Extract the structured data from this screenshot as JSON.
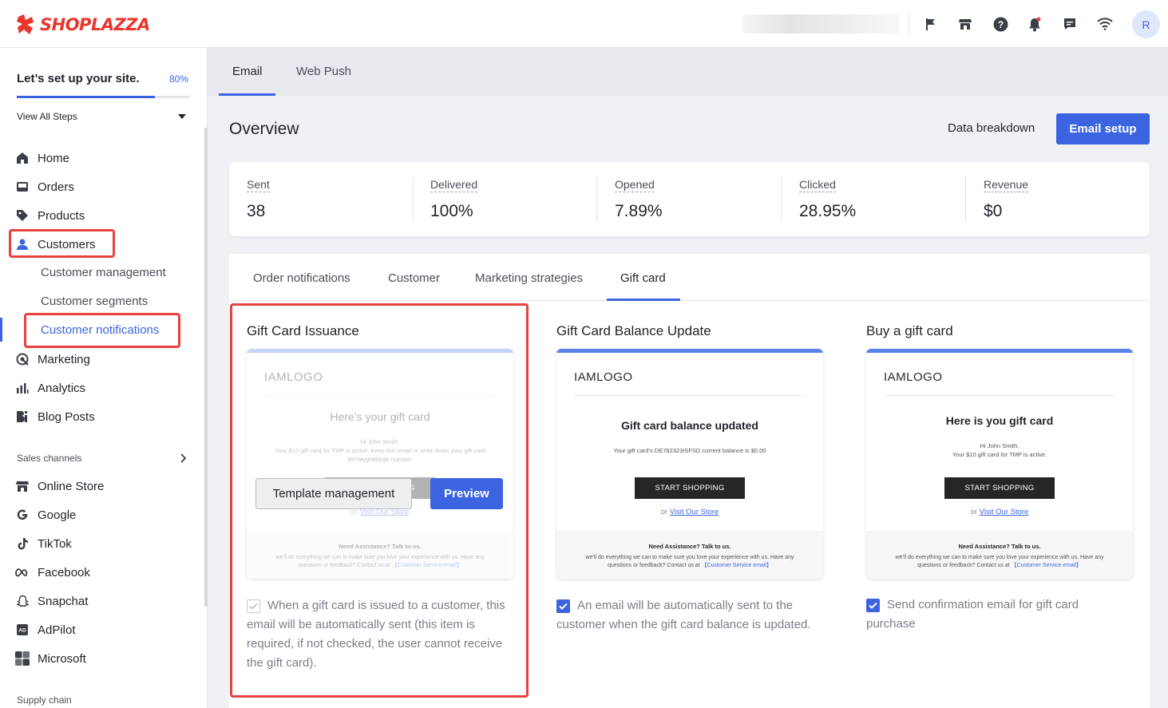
{
  "brand": {
    "name": "SHOPLAZZA",
    "color": "#e8362d",
    "accent": "#3c64e0"
  },
  "topbar": {
    "icons": [
      "flag-icon",
      "store-icon",
      "help-icon",
      "bell-icon",
      "message-icon",
      "wifi-icon"
    ],
    "avatar_initial": "R"
  },
  "setup": {
    "title": "Let’s set up your site.",
    "percent": "80%",
    "progress": 0.8,
    "view_all": "View All Steps"
  },
  "sidebar": {
    "items": [
      {
        "label": "Home",
        "icon": "home-icon"
      },
      {
        "label": "Orders",
        "icon": "orders-icon"
      },
      {
        "label": "Products",
        "icon": "tag-icon"
      },
      {
        "label": "Customers",
        "icon": "person-icon"
      },
      {
        "label": "Marketing",
        "icon": "marketing-icon"
      },
      {
        "label": "Analytics",
        "icon": "analytics-icon"
      },
      {
        "label": "Blog Posts",
        "icon": "blog-icon"
      }
    ],
    "customer_sub": [
      "Customer management",
      "Customer segments",
      "Customer notifications"
    ],
    "sales_channels_label": "Sales channels",
    "channels": [
      {
        "label": "Online Store",
        "icon": "store-icon"
      },
      {
        "label": "Google",
        "icon": "google-icon"
      },
      {
        "label": "TikTok",
        "icon": "tiktok-icon"
      },
      {
        "label": "Facebook",
        "icon": "meta-icon"
      },
      {
        "label": "Snapchat",
        "icon": "snapchat-icon"
      },
      {
        "label": "AdPilot",
        "icon": "adpilot-icon"
      },
      {
        "label": "Microsoft",
        "icon": "microsoft-icon"
      }
    ],
    "supply_chain_label": "Supply chain"
  },
  "top_tabs": [
    "Email",
    "Web Push"
  ],
  "overview": {
    "title": "Overview",
    "data_breakdown": "Data breakdown",
    "email_setup": "Email setup",
    "stats": [
      {
        "label": "Sent",
        "value": "38"
      },
      {
        "label": "Delivered",
        "value": "100%"
      },
      {
        "label": "Opened",
        "value": "7.89%"
      },
      {
        "label": "Clicked",
        "value": "28.95%"
      },
      {
        "label": "Revenue",
        "value": "$0"
      }
    ]
  },
  "panel_tabs": [
    "Order notifications",
    "Customer",
    "Marketing strategies",
    "Gift card"
  ],
  "cards": [
    {
      "title": "Gift Card Issuance",
      "logo": "IAMLOGO",
      "heading": "Here’s your gift card",
      "body": "Hi John Smith,\nYour $10 gift card for TMP is active. Keep this email or write down your gift card 8976tygh89jnjjk number.",
      "button": "START SHOPPING",
      "link_prefix": "or",
      "link": "Visit Our Store",
      "footer_head": "Need Assistance? Talk to us.",
      "footer_body": "we’ll do everything we can to make sure you love your experience with us. Have any questions or feedback? Contact us at",
      "footer_link": "【Customer Service email】",
      "checkbox_text": "When a gift card is issued to a customer, this email will be automatically sent (this item is required, if not checked, the user cannot receive the gift card).",
      "template_button": "Template management",
      "preview_button": "Preview"
    },
    {
      "title": "Gift Card Balance Update",
      "logo": "IAMLOGO",
      "heading": "Gift card balance updated",
      "body": "Your gift card’s DE782323ISFSD current balance is $0.00",
      "button": "START SHOPPING",
      "link_prefix": "or",
      "link": "Visit Our Store",
      "footer_head": "Need Assistance? Talk to us.",
      "footer_body": "we’ll do everything we can to make sure you love your experience with us. Have any questions or feedback? Contact us at",
      "footer_link": "【Customer Service email】",
      "checkbox_text": "An email will be automatically sent to the customer when the gift card balance is updated."
    },
    {
      "title": "Buy a gift card",
      "logo": "IAMLOGO",
      "heading": "Here is you gift card",
      "body": "Hi John Smith,\nYour $10 gift card for TMP is active.",
      "button": "START SHOPPING",
      "link_prefix": "or",
      "link": "Visit Our Store",
      "footer_head": "Need Assistance? Talk to us.",
      "footer_body": "we’ll do everything we can to make sure you love your experience with us. Have any questions or feedback? Contact us at",
      "footer_link": "【Customer Service email】",
      "checkbox_text": "Send confirmation email for gift card purchase"
    }
  ]
}
